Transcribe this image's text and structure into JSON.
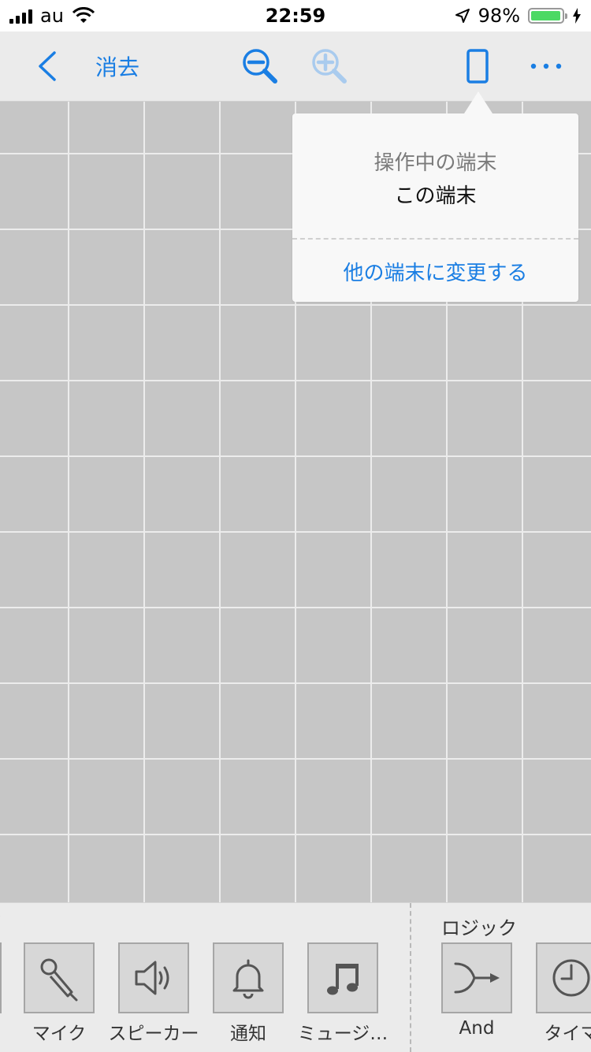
{
  "status_bar": {
    "carrier": "au",
    "time": "22:59",
    "battery_percent": "98%",
    "battery_level": 0.98
  },
  "toolbar": {
    "back_icon": "chevron-left-icon",
    "clear_label": "消去",
    "zoom_out_icon": "zoom-out-icon",
    "zoom_in_icon": "zoom-in-icon",
    "device_icon": "smartphone-icon",
    "more_icon": "ellipsis-icon",
    "accent_color": "#1a7ee3"
  },
  "popover": {
    "heading": "操作中の端末",
    "current_device": "この端末",
    "change_action": "他の端末に変更する"
  },
  "palette": {
    "sections": [
      {
        "title": "ロジック"
      }
    ],
    "tiles": [
      {
        "label": "マイク",
        "icon": "microphone-icon"
      },
      {
        "label": "スピーカー",
        "icon": "speaker-icon"
      },
      {
        "label": "通知",
        "icon": "bell-icon"
      },
      {
        "label": "ミュージ…",
        "icon": "music-note-icon"
      },
      {
        "label": "And",
        "icon": "and-merge-icon"
      },
      {
        "label": "タイマ",
        "icon": "timer-icon"
      }
    ]
  }
}
